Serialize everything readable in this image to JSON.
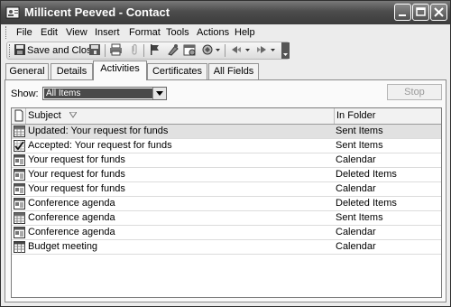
{
  "window": {
    "title": "Millicent Peeved - Contact"
  },
  "menu": [
    "File",
    "Edit",
    "View",
    "Insert",
    "Format",
    "Tools",
    "Actions",
    "Help"
  ],
  "toolbar": {
    "save_close": "Save and Close"
  },
  "tabs": [
    "General",
    "Details",
    "Activities",
    "Certificates",
    "All Fields"
  ],
  "active_tab": "Activities",
  "show": {
    "label": "Show:",
    "value": "All Items"
  },
  "stop_label": "Stop",
  "columns": {
    "subject": "Subject",
    "folder": "In Folder"
  },
  "items": [
    {
      "subject": "Updated: Your request for funds",
      "folder": "Sent Items",
      "icon": "meeting-response-icon",
      "selected": true
    },
    {
      "subject": "Accepted: Your request for funds",
      "folder": "Sent Items",
      "icon": "meeting-accepted-icon",
      "selected": false
    },
    {
      "subject": "Your request for funds",
      "folder": "Calendar",
      "icon": "meeting-request-icon",
      "selected": false
    },
    {
      "subject": "Your request for funds",
      "folder": "Deleted Items",
      "icon": "meeting-request-icon",
      "selected": false
    },
    {
      "subject": "Your request for funds",
      "folder": "Calendar",
      "icon": "meeting-request-icon",
      "selected": false
    },
    {
      "subject": "Conference agenda",
      "folder": "Deleted Items",
      "icon": "meeting-request-icon",
      "selected": false
    },
    {
      "subject": "Conference agenda",
      "folder": "Sent Items",
      "icon": "meeting-response-icon",
      "selected": false
    },
    {
      "subject": "Conference agenda",
      "folder": "Calendar",
      "icon": "meeting-request-icon",
      "selected": false
    },
    {
      "subject": "Budget meeting",
      "folder": "Calendar",
      "icon": "calendar-item-icon",
      "selected": false
    }
  ]
}
